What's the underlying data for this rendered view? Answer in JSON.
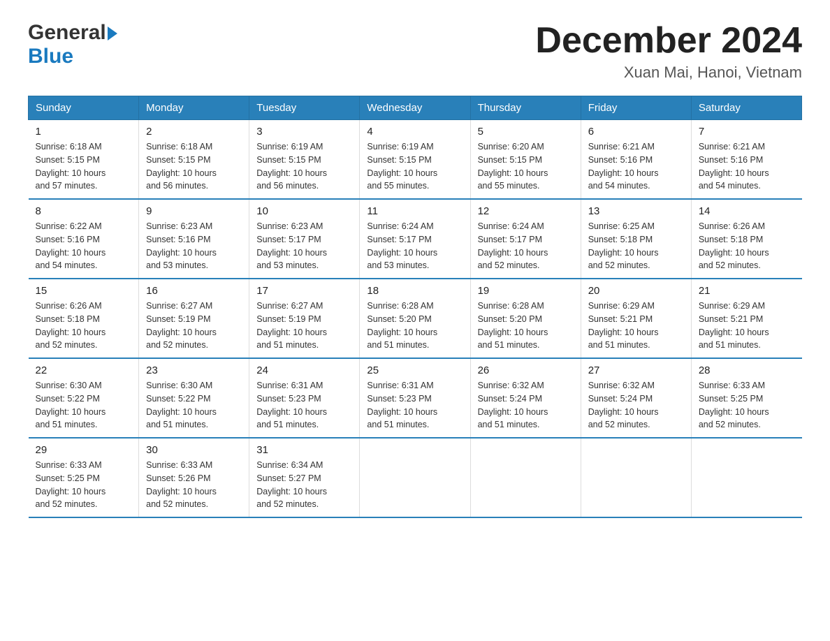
{
  "header": {
    "logo_general": "General",
    "logo_blue": "Blue",
    "month_title": "December 2024",
    "location": "Xuan Mai, Hanoi, Vietnam"
  },
  "days_of_week": [
    "Sunday",
    "Monday",
    "Tuesday",
    "Wednesday",
    "Thursday",
    "Friday",
    "Saturday"
  ],
  "weeks": [
    {
      "cells": [
        {
          "day": "1",
          "sunrise": "6:18 AM",
          "sunset": "5:15 PM",
          "daylight": "10 hours and 57 minutes."
        },
        {
          "day": "2",
          "sunrise": "6:18 AM",
          "sunset": "5:15 PM",
          "daylight": "10 hours and 56 minutes."
        },
        {
          "day": "3",
          "sunrise": "6:19 AM",
          "sunset": "5:15 PM",
          "daylight": "10 hours and 56 minutes."
        },
        {
          "day": "4",
          "sunrise": "6:19 AM",
          "sunset": "5:15 PM",
          "daylight": "10 hours and 55 minutes."
        },
        {
          "day": "5",
          "sunrise": "6:20 AM",
          "sunset": "5:15 PM",
          "daylight": "10 hours and 55 minutes."
        },
        {
          "day": "6",
          "sunrise": "6:21 AM",
          "sunset": "5:16 PM",
          "daylight": "10 hours and 54 minutes."
        },
        {
          "day": "7",
          "sunrise": "6:21 AM",
          "sunset": "5:16 PM",
          "daylight": "10 hours and 54 minutes."
        }
      ]
    },
    {
      "cells": [
        {
          "day": "8",
          "sunrise": "6:22 AM",
          "sunset": "5:16 PM",
          "daylight": "10 hours and 54 minutes."
        },
        {
          "day": "9",
          "sunrise": "6:23 AM",
          "sunset": "5:16 PM",
          "daylight": "10 hours and 53 minutes."
        },
        {
          "day": "10",
          "sunrise": "6:23 AM",
          "sunset": "5:17 PM",
          "daylight": "10 hours and 53 minutes."
        },
        {
          "day": "11",
          "sunrise": "6:24 AM",
          "sunset": "5:17 PM",
          "daylight": "10 hours and 53 minutes."
        },
        {
          "day": "12",
          "sunrise": "6:24 AM",
          "sunset": "5:17 PM",
          "daylight": "10 hours and 52 minutes."
        },
        {
          "day": "13",
          "sunrise": "6:25 AM",
          "sunset": "5:18 PM",
          "daylight": "10 hours and 52 minutes."
        },
        {
          "day": "14",
          "sunrise": "6:26 AM",
          "sunset": "5:18 PM",
          "daylight": "10 hours and 52 minutes."
        }
      ]
    },
    {
      "cells": [
        {
          "day": "15",
          "sunrise": "6:26 AM",
          "sunset": "5:18 PM",
          "daylight": "10 hours and 52 minutes."
        },
        {
          "day": "16",
          "sunrise": "6:27 AM",
          "sunset": "5:19 PM",
          "daylight": "10 hours and 52 minutes."
        },
        {
          "day": "17",
          "sunrise": "6:27 AM",
          "sunset": "5:19 PM",
          "daylight": "10 hours and 51 minutes."
        },
        {
          "day": "18",
          "sunrise": "6:28 AM",
          "sunset": "5:20 PM",
          "daylight": "10 hours and 51 minutes."
        },
        {
          "day": "19",
          "sunrise": "6:28 AM",
          "sunset": "5:20 PM",
          "daylight": "10 hours and 51 minutes."
        },
        {
          "day": "20",
          "sunrise": "6:29 AM",
          "sunset": "5:21 PM",
          "daylight": "10 hours and 51 minutes."
        },
        {
          "day": "21",
          "sunrise": "6:29 AM",
          "sunset": "5:21 PM",
          "daylight": "10 hours and 51 minutes."
        }
      ]
    },
    {
      "cells": [
        {
          "day": "22",
          "sunrise": "6:30 AM",
          "sunset": "5:22 PM",
          "daylight": "10 hours and 51 minutes."
        },
        {
          "day": "23",
          "sunrise": "6:30 AM",
          "sunset": "5:22 PM",
          "daylight": "10 hours and 51 minutes."
        },
        {
          "day": "24",
          "sunrise": "6:31 AM",
          "sunset": "5:23 PM",
          "daylight": "10 hours and 51 minutes."
        },
        {
          "day": "25",
          "sunrise": "6:31 AM",
          "sunset": "5:23 PM",
          "daylight": "10 hours and 51 minutes."
        },
        {
          "day": "26",
          "sunrise": "6:32 AM",
          "sunset": "5:24 PM",
          "daylight": "10 hours and 51 minutes."
        },
        {
          "day": "27",
          "sunrise": "6:32 AM",
          "sunset": "5:24 PM",
          "daylight": "10 hours and 52 minutes."
        },
        {
          "day": "28",
          "sunrise": "6:33 AM",
          "sunset": "5:25 PM",
          "daylight": "10 hours and 52 minutes."
        }
      ]
    },
    {
      "cells": [
        {
          "day": "29",
          "sunrise": "6:33 AM",
          "sunset": "5:25 PM",
          "daylight": "10 hours and 52 minutes."
        },
        {
          "day": "30",
          "sunrise": "6:33 AM",
          "sunset": "5:26 PM",
          "daylight": "10 hours and 52 minutes."
        },
        {
          "day": "31",
          "sunrise": "6:34 AM",
          "sunset": "5:27 PM",
          "daylight": "10 hours and 52 minutes."
        },
        {
          "day": "",
          "sunrise": "",
          "sunset": "",
          "daylight": ""
        },
        {
          "day": "",
          "sunrise": "",
          "sunset": "",
          "daylight": ""
        },
        {
          "day": "",
          "sunrise": "",
          "sunset": "",
          "daylight": ""
        },
        {
          "day": "",
          "sunrise": "",
          "sunset": "",
          "daylight": ""
        }
      ]
    }
  ],
  "labels": {
    "sunrise_prefix": "Sunrise: ",
    "sunset_prefix": "Sunset: ",
    "daylight_prefix": "Daylight: "
  }
}
